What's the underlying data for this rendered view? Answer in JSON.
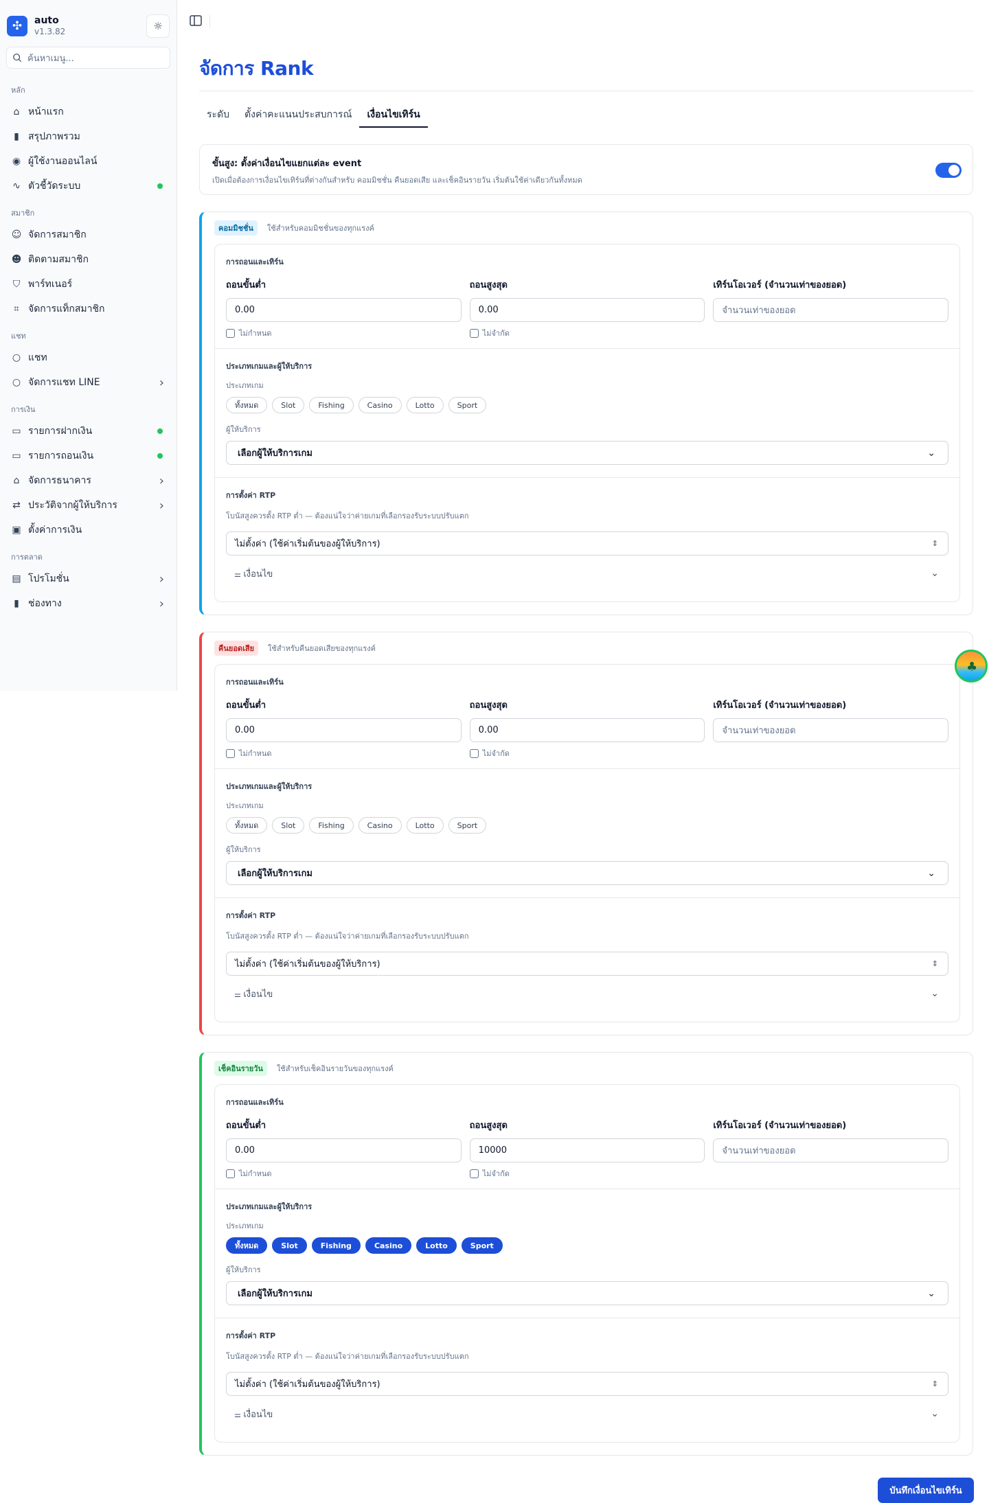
{
  "app": {
    "name": "auto",
    "version": "v1.3.82"
  },
  "search": {
    "placeholder": "ค้นหาเมนู..."
  },
  "sidebar": {
    "groups": [
      {
        "title": "หลัก",
        "items": [
          {
            "label": "หน้าแรก",
            "icon": "home-icon"
          },
          {
            "label": "สรุปภาพรวม",
            "icon": "bar-chart-icon"
          },
          {
            "label": "ผู้ใช้งานออนไลน์",
            "icon": "radio-icon"
          },
          {
            "label": "ตัวชี้วัดระบบ",
            "icon": "activity-icon",
            "status_dot": true
          }
        ]
      },
      {
        "title": "สมาชิก",
        "items": [
          {
            "label": "จัดการสมาชิก",
            "icon": "users-icon"
          },
          {
            "label": "ติดตามสมาชิก",
            "icon": "user-search-icon"
          },
          {
            "label": "พาร์ทเนอร์",
            "icon": "handshake-icon"
          },
          {
            "label": "จัดการแท็กสมาชิก",
            "icon": "tag-icon"
          }
        ]
      },
      {
        "title": "แชท",
        "items": [
          {
            "label": "แชท",
            "icon": "chat-icon"
          },
          {
            "label": "จัดการแชท LINE",
            "icon": "chat-icon",
            "has_children": true
          }
        ]
      },
      {
        "title": "การเงิน",
        "items": [
          {
            "label": "รายการฝากเงิน",
            "icon": "deposit-icon",
            "status_dot": true
          },
          {
            "label": "รายการถอนเงิน",
            "icon": "withdraw-icon",
            "status_dot": true
          },
          {
            "label": "จัดการธนาคาร",
            "icon": "bank-icon",
            "has_children": true
          },
          {
            "label": "ประวัติจากผู้ให้บริการ",
            "icon": "history-icon",
            "has_children": true
          },
          {
            "label": "ตั้งค่าการเงิน",
            "icon": "wallet-icon"
          }
        ]
      },
      {
        "title": "การตลาด",
        "items": [
          {
            "label": "โปรโมชั่น",
            "icon": "gift-icon",
            "has_children": true
          },
          {
            "label": "ช่องทาง",
            "icon": "bar-chart-icon",
            "has_children": true
          }
        ]
      }
    ]
  },
  "page": {
    "title": "จัดการ Rank",
    "tabs": [
      "ระดับ",
      "ตั้งค่าคะแนนประสบการณ์",
      "เงื่อนไขเทิร์น"
    ],
    "active_tab": 2
  },
  "advanced": {
    "title": "ขั้นสูง: ตั้งค่าเงื่อนไขแยกแต่ละ event",
    "desc": "เปิดเมื่อต้องการเงื่อนไขเทิร์นที่ต่างกันสำหรับ คอมมิชชั่น คืนยอดเสีย และเช็คอินรายวัน เริ่มต้นใช้ค่าเดียวกันทั้งหมด",
    "enabled": true
  },
  "labels": {
    "withdraw_section": "การถอนและเทิร์น",
    "min_withdraw": "ถอนขั้นต่ำ",
    "max_withdraw": "ถอนสูงสุด",
    "turnover": "เทิร์นโอเวอร์ (จำนวนเท่าของยอด)",
    "turnover_placeholder": "จำนวนเท่าของยอด",
    "no_min": "ไม่กำหนด",
    "no_max": "ไม่จำกัด",
    "game_section": "ประเภทเกมและผู้ให้บริการ",
    "game_type": "ประเภทเกม",
    "provider": "ผู้ให้บริการ",
    "provider_placeholder": "เลือกผู้ให้บริการเกม",
    "rtp_section": "การตั้งค่า RTP",
    "rtp_desc": "โบนัสสูงควรตั้ง RTP ต่ำ — ต้องแน่ใจว่าค่ายเกมที่เลือกรองรับระบบปรับแตก",
    "rtp_value": "ไม่ตั้งค่า (ใช้ค่าเริ่มต้นของผู้ให้บริการ)",
    "conditions": "เงื่อนไข"
  },
  "game_types": [
    "ทั้งหมด",
    "Slot",
    "Fishing",
    "Casino",
    "Lotto",
    "Sport"
  ],
  "cards": [
    {
      "badge": "คอมมิชชั่น",
      "sub": "ใช้สำหรับคอมมิชชั่นของทุกแรงค์",
      "color": "#0ea5e9",
      "badge_bg": "#e0f2fe",
      "badge_fg": "#0369a1",
      "min": "0.00",
      "max": "0.00",
      "games_selected": false
    },
    {
      "badge": "คืนยอดเสีย",
      "sub": "ใช้สำหรับคืนยอดเสียของทุกแรงค์",
      "color": "#ef4444",
      "badge_bg": "#fee2e2",
      "badge_fg": "#b91c1c",
      "min": "0.00",
      "max": "0.00",
      "games_selected": false
    },
    {
      "badge": "เช็คอินรายวัน",
      "sub": "ใช้สำหรับเช็คอินรายวันของทุกแรงค์",
      "color": "#22c55e",
      "badge_bg": "#dcfce7",
      "badge_fg": "#15803d",
      "min": "0.00",
      "max": "10000",
      "games_selected": true
    }
  ],
  "save_label": "บันทึกเงื่อนไขเทิร์น",
  "colors": {
    "accent": "#1d4ed8",
    "status": "#22c55e"
  }
}
